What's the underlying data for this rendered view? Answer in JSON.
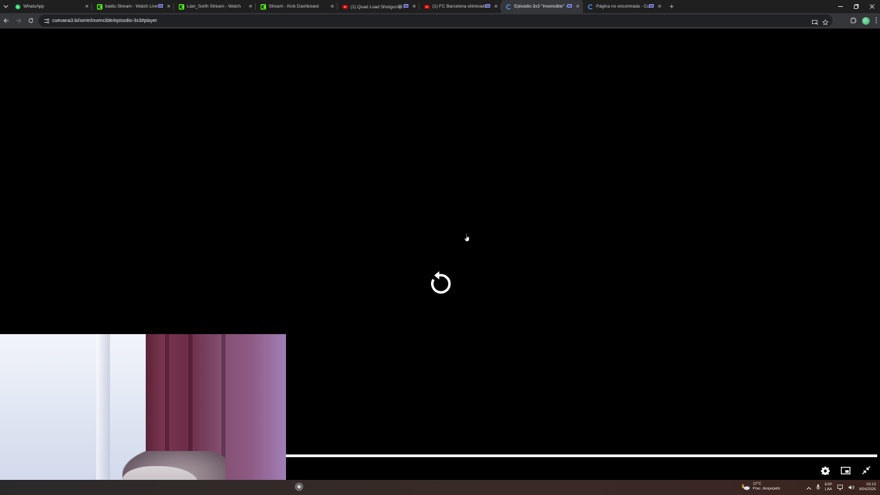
{
  "browser": {
    "tabs": [
      {
        "title": "WhatsApp",
        "icon": "whatsapp-icon",
        "color": "#25d366",
        "media": false
      },
      {
        "title": "baldu Stream - Watch Live",
        "icon": "kick-icon",
        "color": "#53fc18",
        "media": true
      },
      {
        "title": "Lian_Sorth Stream - Watch Live",
        "icon": "kick-icon",
        "color": "#53fc18",
        "media": false
      },
      {
        "title": "Stream - Kick Dashboard",
        "icon": "kick-icon",
        "color": "#53fc18",
        "media": false
      },
      {
        "title": "(1) Quad Load Shotgun😂🤘",
        "icon": "youtube-icon",
        "color": "#ff0000",
        "media": true
      },
      {
        "title": "(1) FC Barcelona eliminado",
        "icon": "youtube-icon",
        "color": "#ff0000",
        "media": true
      },
      {
        "title": "Episodio 3x3 \"Invencible\" -",
        "icon": "cuevana-icon",
        "color": "#4da3ff",
        "media": true,
        "active": true
      },
      {
        "title": "Página no encontrada - Cu",
        "icon": "cuevana-icon",
        "color": "#4da3ff",
        "media": true
      }
    ],
    "new_tab_label": "+",
    "url": "cuevana3.bi/serie/invencible/episodio-3x3#player"
  },
  "taskbar": {
    "weather_temp": "12°C",
    "weather_desc": "Prac. despejado",
    "lang_line1": "ESP",
    "lang_line2": "LAA",
    "time": "03:13",
    "date": "9/04/2026"
  }
}
